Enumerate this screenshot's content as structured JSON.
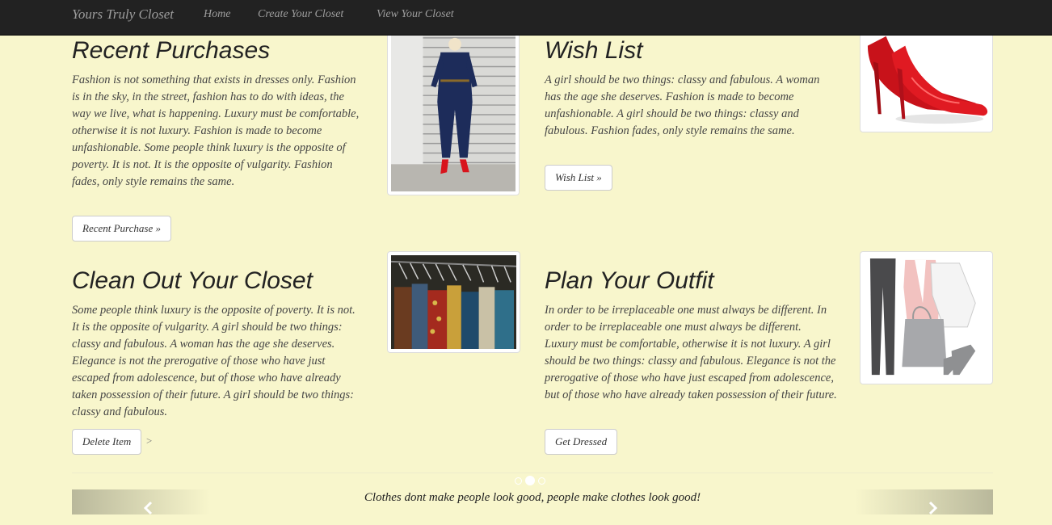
{
  "nav": {
    "brand": "Yours Truly Closet",
    "links": [
      "Home",
      "Create Your Closet",
      "View Your Closet"
    ]
  },
  "sections": [
    {
      "title": "Recent Purchases",
      "text": "Fashion is not something that exists in dresses only. Fashion is in the sky, in the street, fashion has to do with ideas, the way we live, what is happening. Luxury must be comfortable, otherwise it is not luxury. Fashion is made to become unfashionable. Some people think luxury is the opposite of poverty. It is not. It is the opposite of vulgarity. Fashion fades, only style remains the same.",
      "button": "Recent Purchase »",
      "image": "woman-in-navy-jumpsuit-photo"
    },
    {
      "title": "Wish List",
      "text": "A girl should be two things: classy and fabulous. A woman has the age she deserves. Fashion is made to become unfashionable. A girl should be two things: classy and fabulous. Fashion fades, only style remains the same.",
      "button": "Wish List »",
      "image": "red-high-heel-shoes-photo"
    },
    {
      "title": "Clean Out Your Closet",
      "text": "Some people think luxury is the opposite of poverty. It is not. It is the opposite of vulgarity. A girl should be two things: classy and fabulous. A woman has the age she deserves. Elegance is not the prerogative of those who have just escaped from adolescence, but of those who have already taken possession of their future. A girl should be two things: classy and fabulous.",
      "button": "Delete Item",
      "stray": ">",
      "image": "clothes-rack-photo"
    },
    {
      "title": "Plan Your Outfit",
      "text": "In order to be irreplaceable one must always be different. In order to be irreplaceable one must always be different. Luxury must be comfortable, otherwise it is not luxury. A girl should be two things: classy and fabulous. Elegance is not the prerogative of those who have just escaped from adolescence, but of those who have already taken possession of their future.",
      "button": "Get Dressed",
      "image": "outfit-collage-photo"
    }
  ],
  "carousel": {
    "quote": "Clothes dont make people look good, people make clothes look good!",
    "active_index": 1,
    "indicator_count": 3,
    "prev_icon": "chevron-left-icon",
    "next_icon": "chevron-right-icon"
  },
  "colors": {
    "page_background": "#f8f6cc",
    "navbar": "#222222",
    "nav_text": "#9d9d9d"
  }
}
